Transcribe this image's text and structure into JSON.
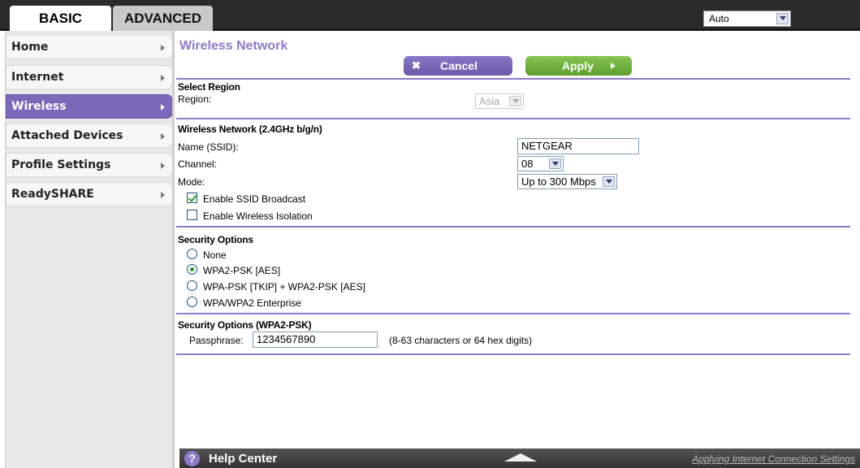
{
  "tabs": {
    "basic": "BASIC",
    "advanced": "ADVANCED"
  },
  "language_select": {
    "value": "Auto"
  },
  "sidebar": {
    "items": [
      {
        "label": "Home"
      },
      {
        "label": "Internet"
      },
      {
        "label": "Wireless",
        "active": true
      },
      {
        "label": "Attached Devices"
      },
      {
        "label": "Profile Settings"
      },
      {
        "label": "ReadySHARE"
      }
    ]
  },
  "main": {
    "title": "Wireless Network",
    "cancel_label": "Cancel",
    "apply_label": "Apply",
    "region_section": {
      "title": "Select Region",
      "region_label": "Region:",
      "region_value": "Asia"
    },
    "wireless_section": {
      "title": "Wireless Network (2.4GHz b/g/n)",
      "ssid_label": "Name (SSID):",
      "ssid_value": "NETGEAR",
      "channel_label": "Channel:",
      "channel_value": "08",
      "mode_label": "Mode:",
      "mode_value": "Up to 300 Mbps",
      "enable_ssid_broadcast": {
        "label": "Enable SSID Broadcast",
        "checked": true
      },
      "enable_wireless_isolation": {
        "label": "Enable Wireless Isolation",
        "checked": false
      }
    },
    "security_section": {
      "title": "Security Options",
      "options": [
        {
          "label": "None",
          "checked": false
        },
        {
          "label": "WPA2-PSK [AES]",
          "checked": true
        },
        {
          "label": "WPA-PSK [TKIP] + WPA2-PSK [AES]",
          "checked": false
        },
        {
          "label": "WPA/WPA2 Enterprise",
          "checked": false
        }
      ]
    },
    "passphrase_section": {
      "title": "Security Options (WPA2-PSK)",
      "passphrase_label": "Passphrase:",
      "passphrase_value": "1234567890",
      "hint": "(8-63 characters or 64 hex digits)"
    }
  },
  "help_bar": {
    "label": "Help Center",
    "link": "Applying Internet Connection Settings"
  },
  "colors": {
    "accent": "#8c7bc7",
    "active_menu": "#7a68b8",
    "apply_green": "#6fb33e",
    "topbar": "#2b2b2b"
  },
  "icons": {
    "cancel": "close-icon",
    "apply": "chevron-right-icon",
    "help": "help-icon",
    "help_toggle": "triangle-up-icon"
  }
}
